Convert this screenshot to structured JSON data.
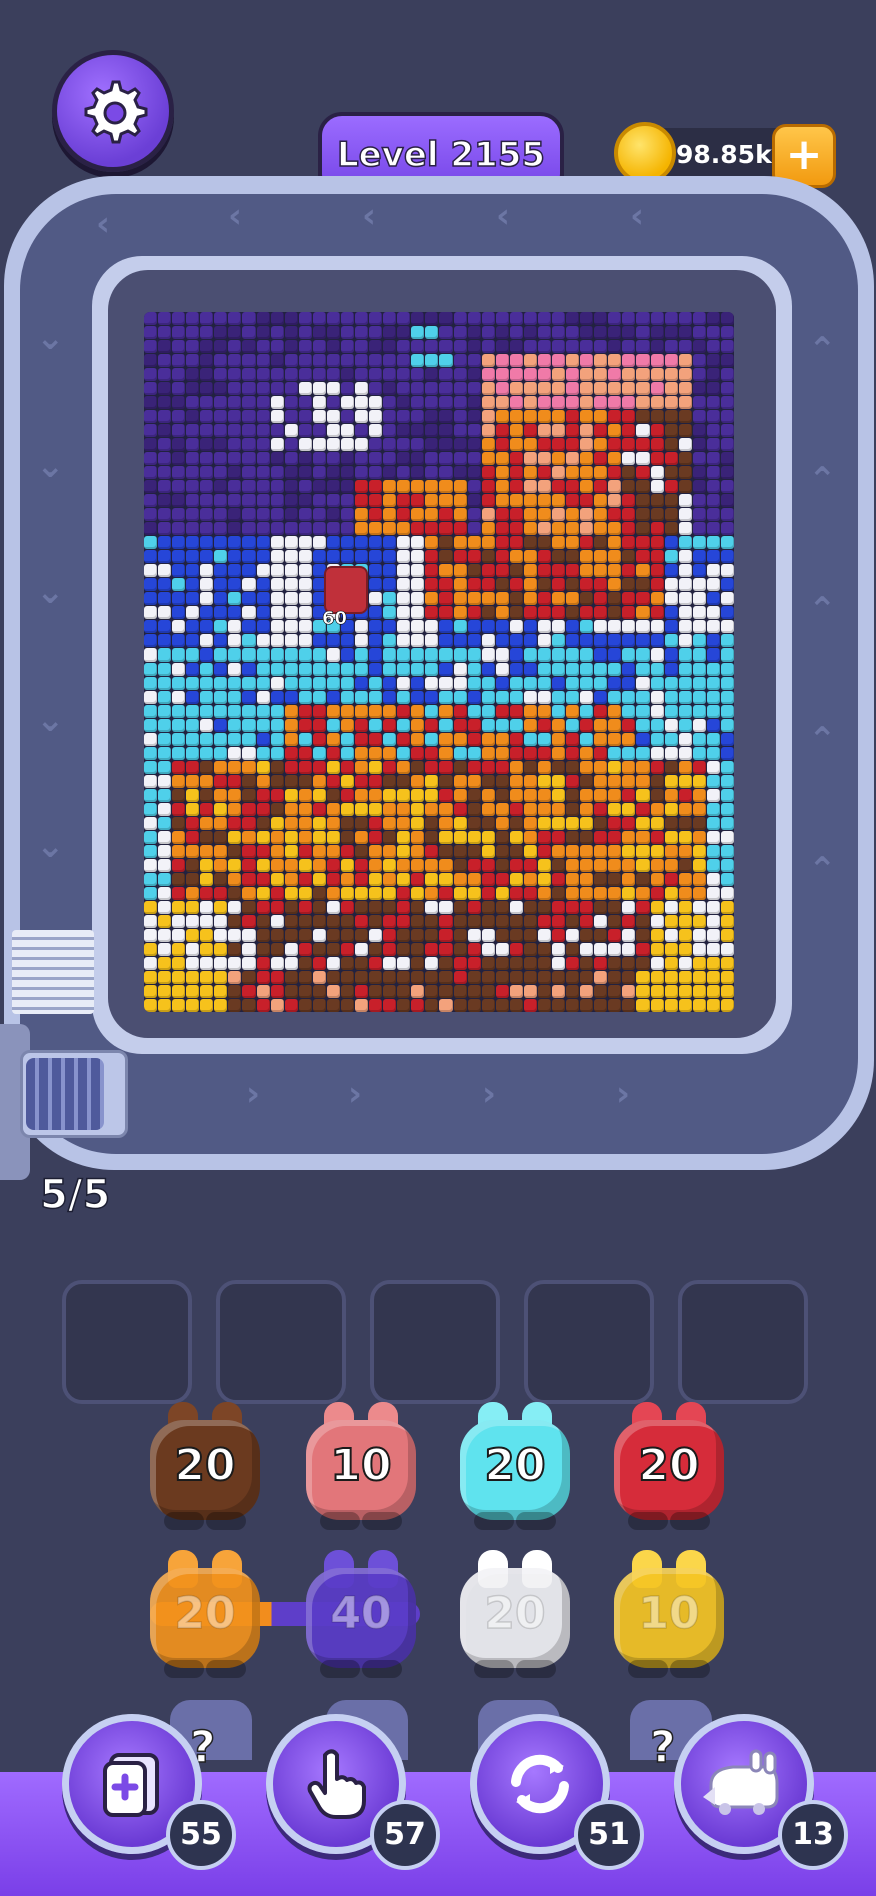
{
  "header": {
    "level_label": "Level 2155",
    "coins": "98.85k",
    "settings_icon": "gear-icon",
    "add_coins_icon": "plus-icon"
  },
  "board": {
    "marker_count": "60",
    "palette": {
      "P": "#4a2e9a",
      "D": "#3a2378",
      "B": "#2646d8",
      "C": "#4fd0ea",
      "W": "#f2f2f8",
      "R": "#c8202a",
      "O": "#f08c1c",
      "Y": "#f6c21c",
      "N": "#6a3a22",
      "K": "#f07aa8",
      "S": "#f3a27c"
    }
  },
  "feeder": {
    "pieces": "5/5"
  },
  "queue": {
    "top_row": [
      {
        "value": "20",
        "color": "#6b3a1f",
        "ear": "#7d4526"
      },
      {
        "value": "10",
        "color": "#e2767a",
        "ear": "#ec8a8c"
      },
      {
        "value": "20",
        "color": "#5fe3ee",
        "ear": "#86eef5"
      },
      {
        "value": "20",
        "color": "#d62c3a",
        "ear": "#e44654"
      }
    ],
    "second_row": [
      {
        "value": "20",
        "color": "#f2921c",
        "ear": "#f7a43a"
      },
      {
        "value": "40",
        "color": "#5a3cc8",
        "ear": "#6d50d8"
      },
      {
        "value": "20",
        "color": "#f1f1f4",
        "ear": "#ffffff"
      },
      {
        "value": "10",
        "color": "#f5c524",
        "ear": "#fbd64a"
      }
    ],
    "hidden_label": "?"
  },
  "boosters": [
    {
      "icon": "add-slot-icon",
      "count": "55"
    },
    {
      "icon": "pointer-hand-icon",
      "count": "57"
    },
    {
      "icon": "shuffle-icon",
      "count": "51"
    },
    {
      "icon": "bunny-train-icon",
      "count": "13"
    }
  ]
}
